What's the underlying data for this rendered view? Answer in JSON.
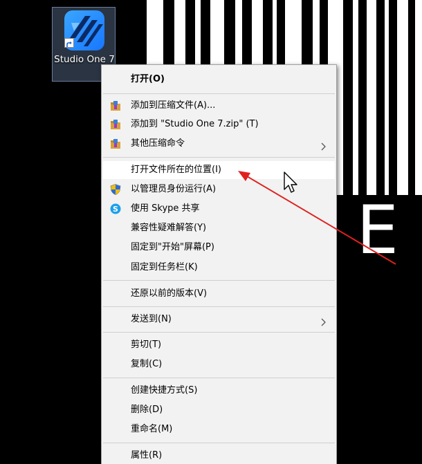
{
  "desktop": {
    "icon_label": "Studio One 7",
    "wallpaper_text": "E"
  },
  "menu": {
    "open": "打开(O)",
    "add_to_archive": "添加到压缩文件(A)...",
    "add_to_zip": "添加到 \"Studio One 7.zip\" (T)",
    "other_compress": "其他压缩命令",
    "open_location": "打开文件所在的位置(I)",
    "run_as_admin": "以管理员身份运行(A)",
    "share_skype": "使用 Skype 共享",
    "compat": "兼容性疑难解答(Y)",
    "pin_start": "固定到\"开始\"屏幕(P)",
    "pin_taskbar": "固定到任务栏(K)",
    "restore_versions": "还原以前的版本(V)",
    "send_to": "发送到(N)",
    "cut": "剪切(T)",
    "copy": "复制(C)",
    "create_shortcut": "创建快捷方式(S)",
    "delete": "删除(D)",
    "rename": "重命名(M)",
    "properties": "属性(R)"
  },
  "colors": {
    "menu_bg": "#f2f2f2",
    "highlight": "#ffffff",
    "annotation": "#e02020",
    "app_blue": "#1e88ff"
  },
  "icons": {
    "archive": "winrar-archive-icon",
    "shield": "uac-shield-icon",
    "skype": "skype-icon",
    "chevron": "chevron-right-icon"
  }
}
